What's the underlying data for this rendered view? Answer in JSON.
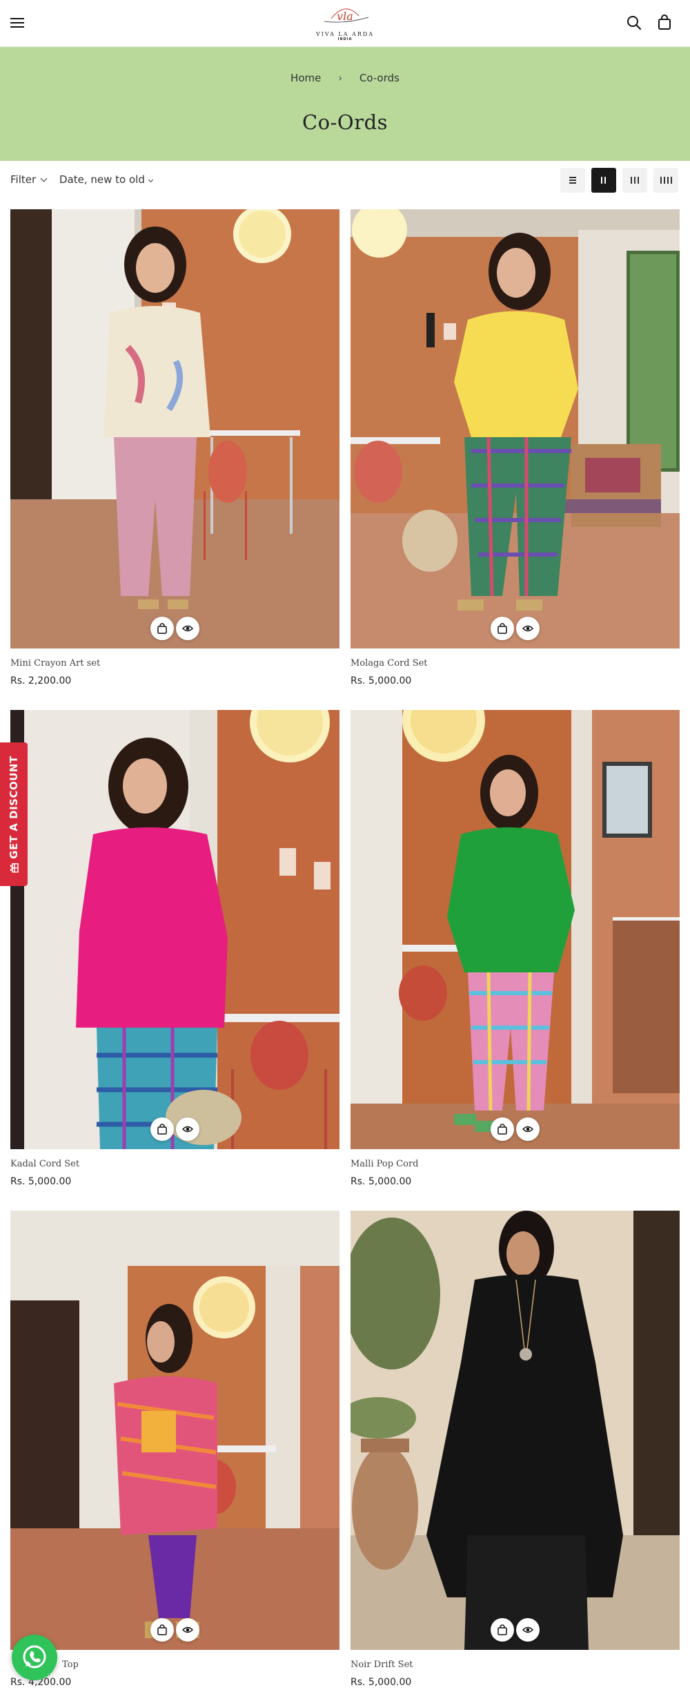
{
  "header": {
    "menu_icon": "hamburger-menu-icon",
    "logo_text": "VIVA LA ARDA",
    "logo_sub": "INDIA",
    "logo_mark": "vla",
    "search_icon": "search-icon",
    "cart_icon": "shopping-bag-icon"
  },
  "breadcrumb": {
    "home": "Home",
    "separator": "›",
    "current": "Co-ords"
  },
  "page_title": "Co-Ords",
  "toolbar": {
    "filter_label": "Filter",
    "sort_label": "Date, new to old",
    "layout_options": [
      "list",
      "2-columns",
      "3-columns",
      "4-columns"
    ],
    "layout_selected": "2-columns"
  },
  "products": [
    {
      "name": "Mini Crayon Art set",
      "price": "Rs. 2,200.00"
    },
    {
      "name": "Molaga Cord Set",
      "price": "Rs. 5,000.00"
    },
    {
      "name": "Kadal Cord Set",
      "price": "Rs. 5,000.00"
    },
    {
      "name": "Malli Pop Cord",
      "price": "Rs. 5,000.00"
    },
    {
      "name": "Top",
      "price": "Rs. 4,200.00"
    },
    {
      "name": "Noir Drift Set",
      "price": "Rs. 5,000.00"
    }
  ],
  "discount_tab": {
    "label": "GET A DISCOUNT",
    "icon": "gift-icon"
  },
  "whatsapp": {
    "icon": "whatsapp-icon"
  },
  "colors": {
    "banner": "#b9d99b",
    "discount": "#d82a3a",
    "whatsapp": "#2fc35a",
    "active_layout": "#1a1a1a"
  }
}
